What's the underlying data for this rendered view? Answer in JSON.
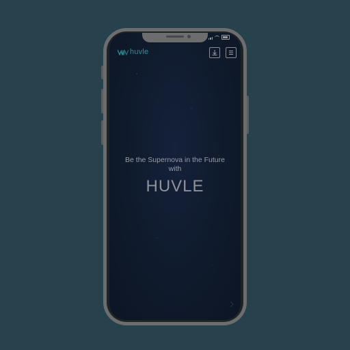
{
  "app": {
    "logo_text": "huvle",
    "logo_mark": "huvle-wing-logo"
  },
  "status_bar": {
    "icons": [
      "signal-icon",
      "wifi-icon",
      "battery-icon"
    ]
  },
  "header": {
    "download_icon": "download-icon",
    "menu_icon": "hamburger-menu-icon"
  },
  "hero": {
    "tagline_line1": "Be the Supernova in the Future",
    "tagline_line2": "with",
    "brand": "HUVLE"
  },
  "colors": {
    "background": "#27414d",
    "logo_accent": "#2f8f96",
    "screen": "#0f1a2c"
  }
}
